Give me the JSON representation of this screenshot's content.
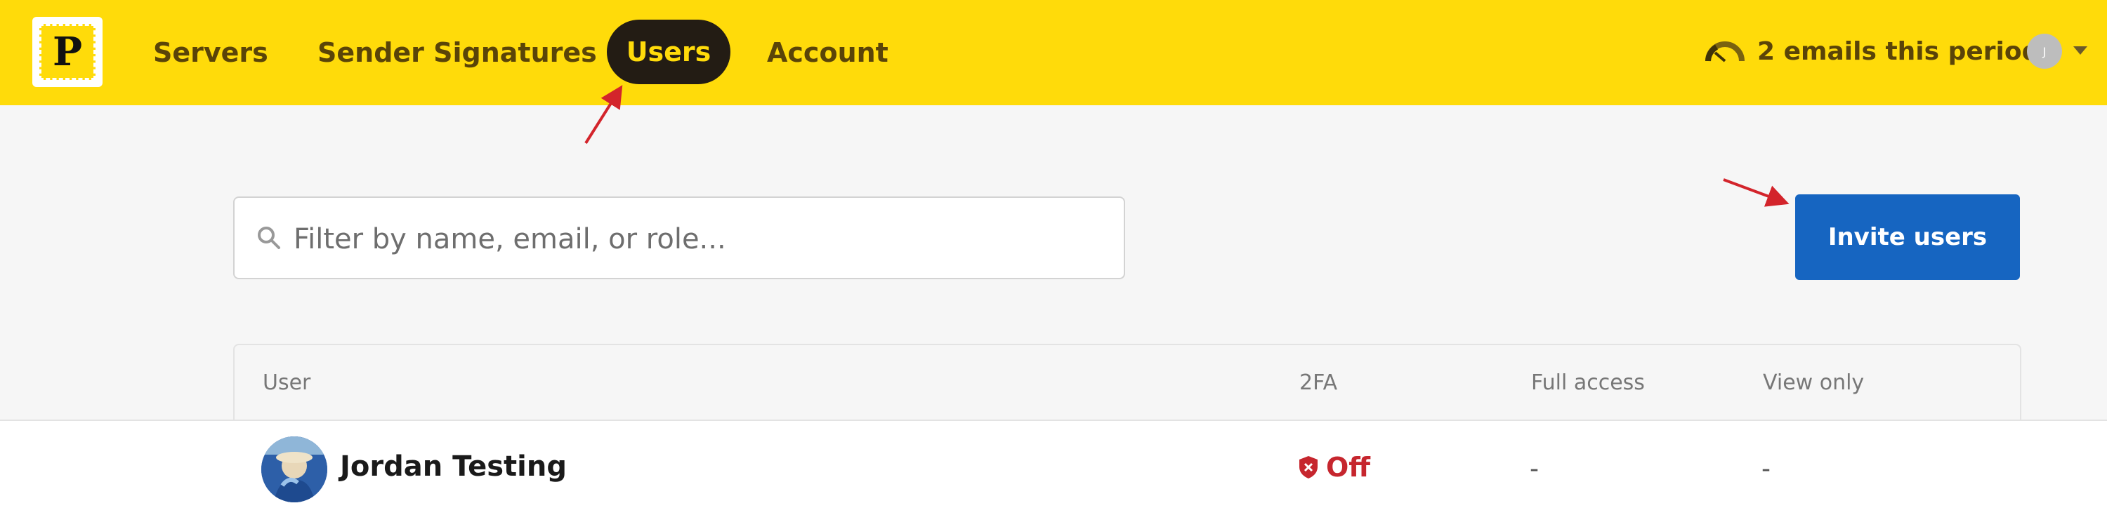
{
  "app": {
    "logo_letter": "P",
    "brand_color": "#ffdb0a",
    "accent_color": "#1665c1"
  },
  "nav": {
    "items": [
      {
        "label": "Servers",
        "active": false
      },
      {
        "label": "Sender Signatures",
        "active": false
      },
      {
        "label": "Users",
        "active": true
      },
      {
        "label": "Account",
        "active": false
      }
    ]
  },
  "usage": {
    "icon": "gauge-icon",
    "text": "2 emails this period"
  },
  "account": {
    "avatar_initial": "J",
    "menu_icon": "caret-down-icon"
  },
  "search": {
    "placeholder": "Filter by name, email, or role...",
    "value": ""
  },
  "actions": {
    "invite_label": "Invite users"
  },
  "table": {
    "columns": [
      "User",
      "2FA",
      "Full access",
      "View only"
    ],
    "rows": [
      {
        "user": "Jordan Testing",
        "twofa": "Off",
        "full_access": "-",
        "view_only": "-"
      }
    ]
  },
  "status_colors": {
    "twofa_off": "#c6262e"
  }
}
